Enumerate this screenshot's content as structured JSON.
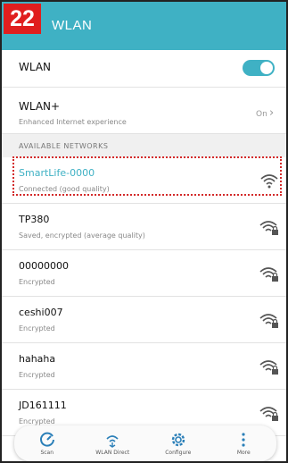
{
  "step_number": "22",
  "header": {
    "title": "WLAN"
  },
  "wlan": {
    "label": "WLAN",
    "enabled": true
  },
  "wlan_plus": {
    "label": "WLAN+",
    "subtitle": "Enhanced Internet experience",
    "value": "On"
  },
  "section_title": "AVAILABLE NETWORKS",
  "networks": [
    {
      "name": "SmartLife-0000",
      "status": "Connected (good quality)"
    },
    {
      "name": "TP380",
      "status": "Saved, encrypted (average quality)"
    },
    {
      "name": "00000000",
      "status": "Encrypted"
    },
    {
      "name": "ceshi007",
      "status": "Encrypted"
    },
    {
      "name": "hahaha",
      "status": "Encrypted"
    },
    {
      "name": "JD161111",
      "status": "Encrypted"
    }
  ],
  "bottom_bar": {
    "scan": "Scan",
    "wlan_direct": "WLAN Direct",
    "configure": "Configure",
    "more": "More"
  },
  "colors": {
    "accent": "#3fb1c4",
    "step_badge": "#e01e1e",
    "highlight": "#d32a2a"
  }
}
